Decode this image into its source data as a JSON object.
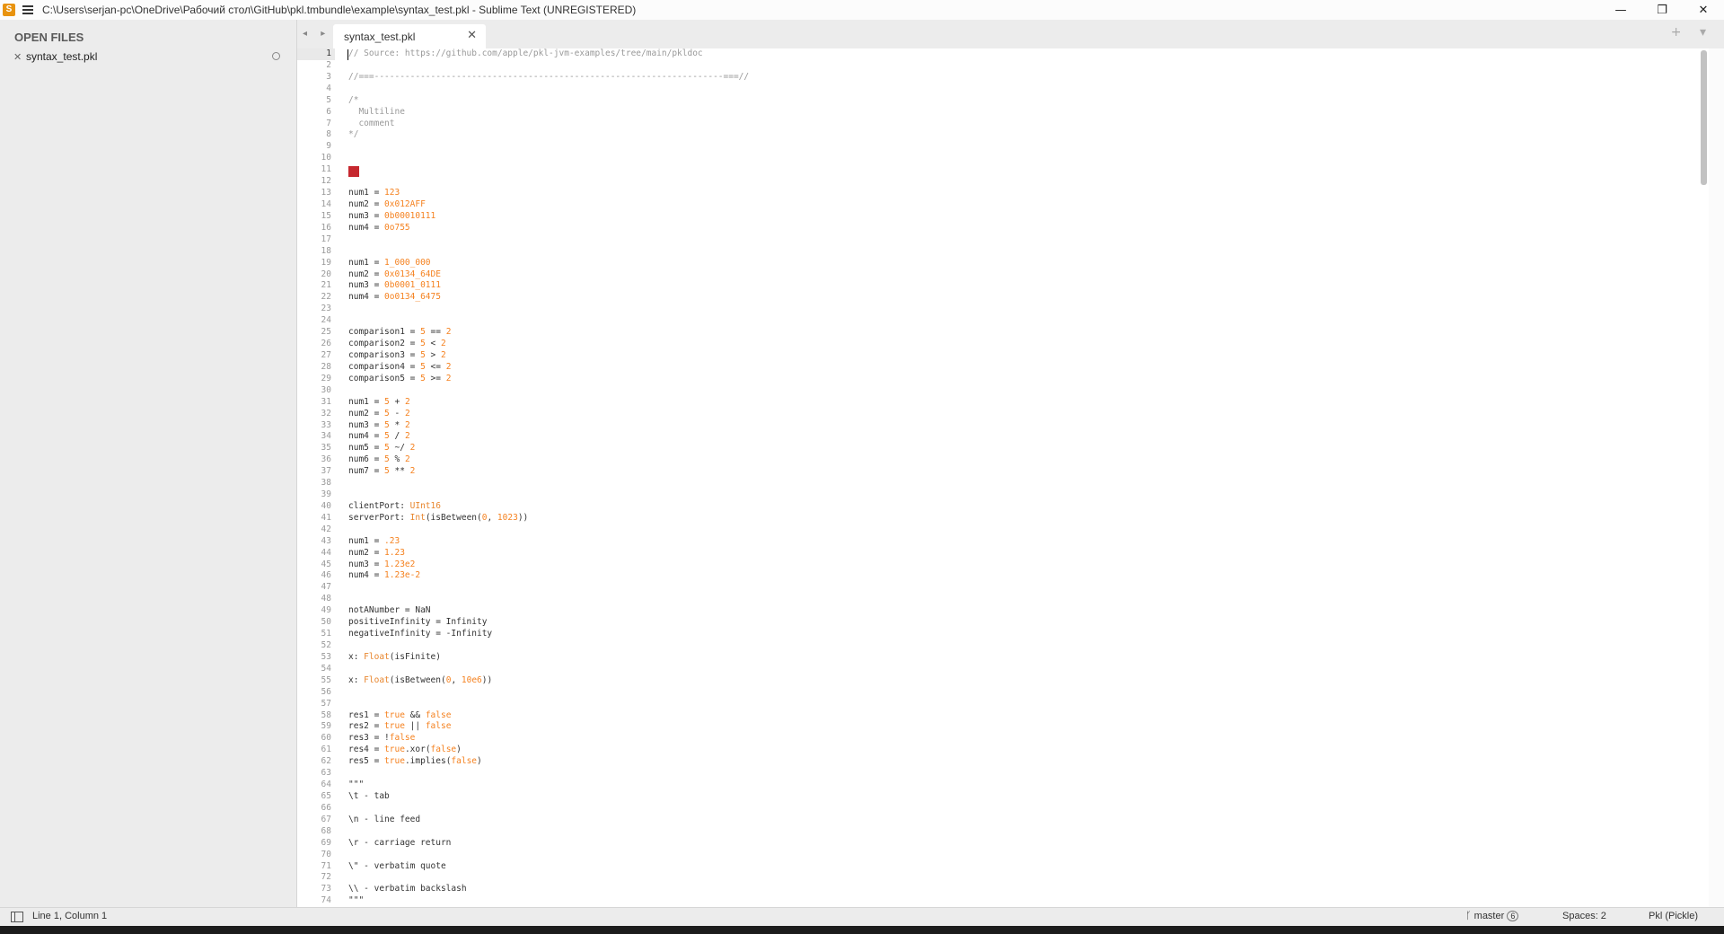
{
  "window": {
    "title": "C:\\Users\\serjan-pc\\OneDrive\\Рабочий стол\\GitHub\\pkl.tmbundle\\example\\syntax_test.pkl - Sublime Text (UNREGISTERED)",
    "controls": {
      "minimize": "—",
      "restore": "❐",
      "close": "✕"
    }
  },
  "sidebar": {
    "title": "OPEN FILES",
    "files": [
      {
        "name": "syntax_test.pkl",
        "close": "✕"
      }
    ]
  },
  "tabbar": {
    "arrows": "◂ ▸",
    "tabs": [
      {
        "label": "syntax_test.pkl",
        "close": "✕"
      }
    ],
    "right_controls": "+ ▾"
  },
  "editor": {
    "lines": [
      "// Source: https://github.com/apple/pkl-jvm-examples/tree/main/pkldoc",
      "",
      "//===--------------------------------------------------------------------===//",
      "",
      "/*",
      "  Multiline",
      "  comment",
      "*/",
      "",
      "",
      "",
      "",
      "num1 = 123",
      "num2 = 0x012AFF",
      "num3 = 0b00010111",
      "num4 = 0o755",
      "",
      "",
      "num1 = 1_000_000",
      "num2 = 0x0134_64DE",
      "num3 = 0b0001_0111",
      "num4 = 0o0134_6475",
      "",
      "",
      "comparison1 = 5 == 2",
      "comparison2 = 5 < 2",
      "comparison3 = 5 > 2",
      "comparison4 = 5 <= 2",
      "comparison5 = 5 >= 2",
      "",
      "num1 = 5 + 2",
      "num2 = 5 - 2",
      "num3 = 5 * 2",
      "num4 = 5 / 2",
      "num5 = 5 ~/ 2",
      "num6 = 5 % 2",
      "num7 = 5 ** 2",
      "",
      "",
      "clientPort: UInt16",
      "serverPort: Int(isBetween(0, 1023))",
      "",
      "num1 = .23",
      "num2 = 1.23",
      "num3 = 1.23e2",
      "num4 = 1.23e-2",
      "",
      "",
      "notANumber = NaN",
      "positiveInfinity = Infinity",
      "negativeInfinity = -Infinity",
      "",
      "x: Float(isFinite)",
      "",
      "x: Float(isBetween(0, 10e6))",
      "",
      "",
      "res1 = true && false",
      "res2 = true || false",
      "res3 = !false",
      "res4 = true.xor(false)",
      "res5 = true.implies(false)",
      "",
      "\"\"\"",
      "\\t - tab",
      "",
      "\\n - line feed",
      "",
      "\\r - carriage return",
      "",
      "\\\" - verbatim quote",
      "",
      "\\\\ - verbatim backslash",
      "\"\"\""
    ]
  },
  "statusbar": {
    "position": "Line 1, Column 1",
    "branch": "master",
    "branch_badge": "6",
    "spaces": "Spaces: 2",
    "syntax": "Pkl (Pickle)"
  },
  "colors": {
    "number": "#f58220",
    "comment": "#999999",
    "type": "#e8862e",
    "error": "#c6282f"
  }
}
